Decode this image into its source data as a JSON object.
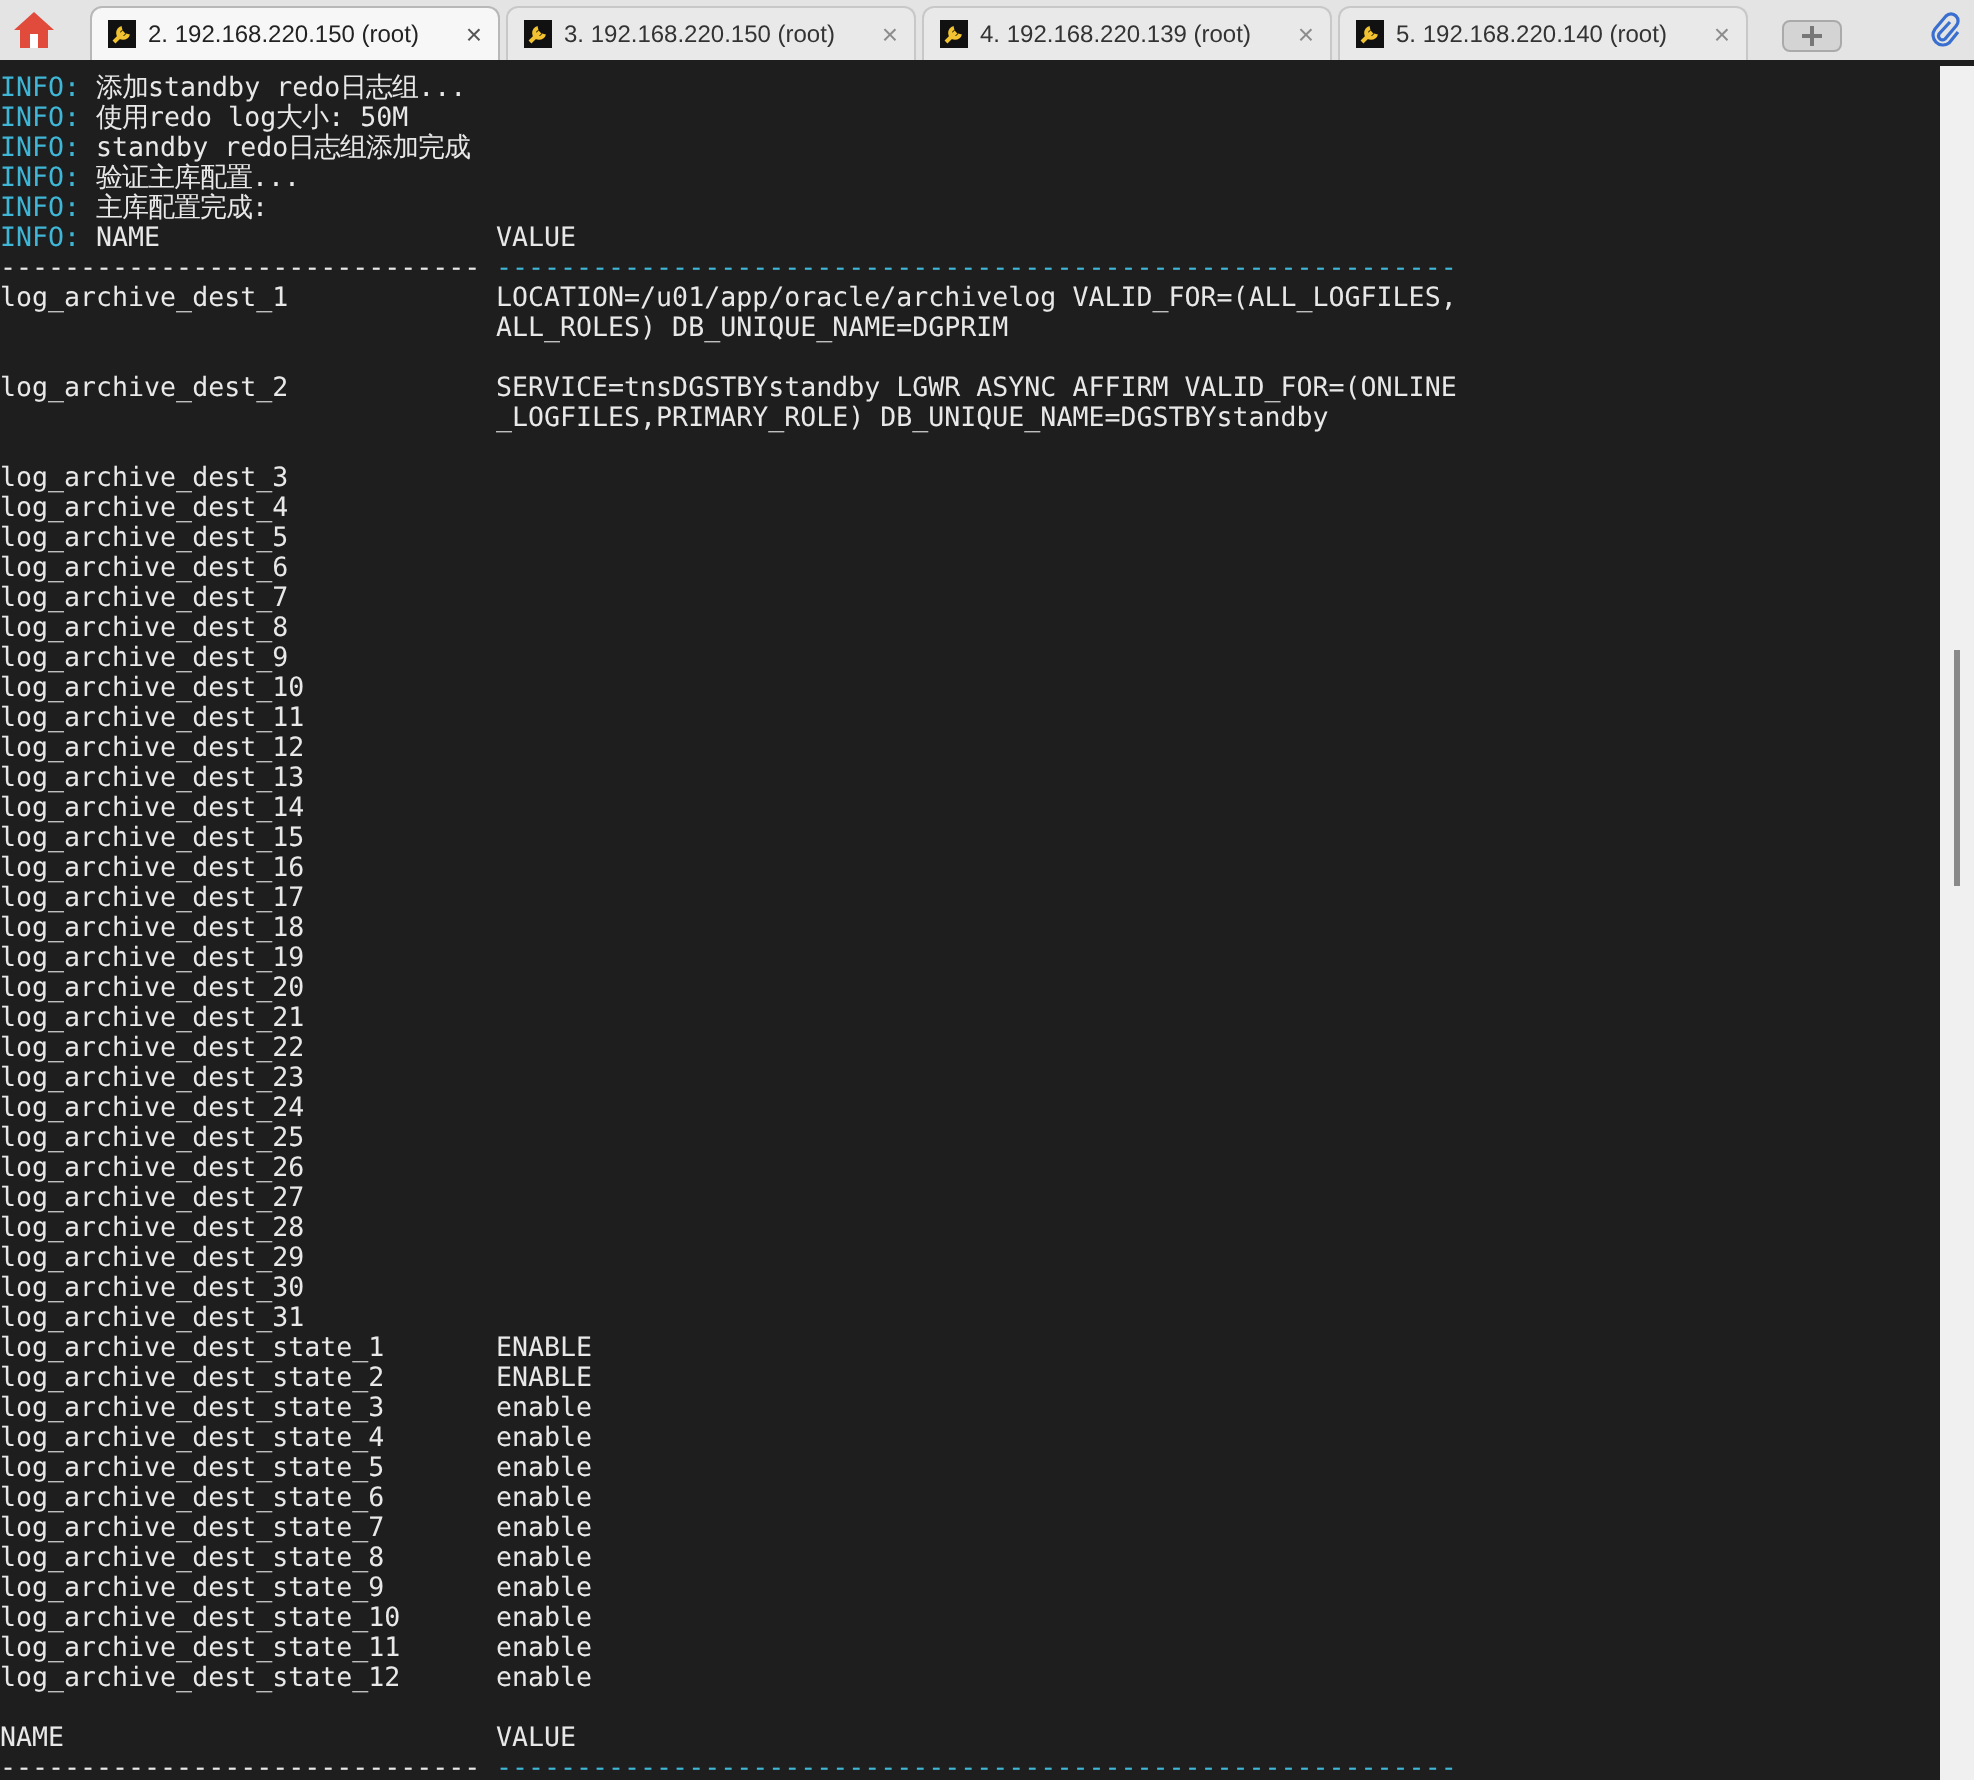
{
  "tabs": [
    {
      "label": "2. 192.168.220.150 (root)",
      "selected": true,
      "close": "×"
    },
    {
      "label": "3. 192.168.220.150 (root)",
      "selected": false,
      "close": "×"
    },
    {
      "label": "4. 192.168.220.139 (root)",
      "selected": false,
      "close": "×"
    },
    {
      "label": "5. 192.168.220.140 (root)",
      "selected": false,
      "close": "×"
    }
  ],
  "terminal": {
    "lines": [
      {
        "kind": "info",
        "prefix": "INFO:",
        "text": "添加standby redo日志组..."
      },
      {
        "kind": "info",
        "prefix": "INFO:",
        "text": "使用redo log大小: 50M"
      },
      {
        "kind": "info",
        "prefix": "INFO:",
        "text": "standby redo日志组添加完成"
      },
      {
        "kind": "info",
        "prefix": "INFO:",
        "text": "验证主库配置..."
      },
      {
        "kind": "info",
        "prefix": "INFO:",
        "text": "主库配置完成:"
      },
      {
        "kind": "header",
        "prefix": "INFO:",
        "name": "NAME",
        "value": "VALUE"
      },
      {
        "kind": "rule",
        "left": "------------------------------",
        "right": "------------------------------------------------------------"
      },
      {
        "kind": "row",
        "name": "log_archive_dest_1",
        "value": [
          "LOCATION=/u01/app/oracle/archivelog VALID_FOR=(ALL_LOGFILES,",
          "ALL_ROLES) DB_UNIQUE_NAME=DGPRIM"
        ]
      },
      {
        "kind": "blank"
      },
      {
        "kind": "row",
        "name": "log_archive_dest_2",
        "value": [
          "SERVICE=tnsDGSTBYstandby LGWR ASYNC AFFIRM VALID_FOR=(ONLINE",
          "_LOGFILES,PRIMARY_ROLE) DB_UNIQUE_NAME=DGSTBYstandby"
        ]
      },
      {
        "kind": "blank"
      },
      {
        "kind": "row",
        "name": "log_archive_dest_3"
      },
      {
        "kind": "row",
        "name": "log_archive_dest_4"
      },
      {
        "kind": "row",
        "name": "log_archive_dest_5"
      },
      {
        "kind": "row",
        "name": "log_archive_dest_6"
      },
      {
        "kind": "row",
        "name": "log_archive_dest_7"
      },
      {
        "kind": "row",
        "name": "log_archive_dest_8"
      },
      {
        "kind": "row",
        "name": "log_archive_dest_9"
      },
      {
        "kind": "row",
        "name": "log_archive_dest_10"
      },
      {
        "kind": "row",
        "name": "log_archive_dest_11"
      },
      {
        "kind": "row",
        "name": "log_archive_dest_12"
      },
      {
        "kind": "row",
        "name": "log_archive_dest_13"
      },
      {
        "kind": "row",
        "name": "log_archive_dest_14"
      },
      {
        "kind": "row",
        "name": "log_archive_dest_15"
      },
      {
        "kind": "row",
        "name": "log_archive_dest_16"
      },
      {
        "kind": "row",
        "name": "log_archive_dest_17"
      },
      {
        "kind": "row",
        "name": "log_archive_dest_18"
      },
      {
        "kind": "row",
        "name": "log_archive_dest_19"
      },
      {
        "kind": "row",
        "name": "log_archive_dest_20"
      },
      {
        "kind": "row",
        "name": "log_archive_dest_21"
      },
      {
        "kind": "row",
        "name": "log_archive_dest_22"
      },
      {
        "kind": "row",
        "name": "log_archive_dest_23"
      },
      {
        "kind": "row",
        "name": "log_archive_dest_24"
      },
      {
        "kind": "row",
        "name": "log_archive_dest_25"
      },
      {
        "kind": "row",
        "name": "log_archive_dest_26"
      },
      {
        "kind": "row",
        "name": "log_archive_dest_27"
      },
      {
        "kind": "row",
        "name": "log_archive_dest_28"
      },
      {
        "kind": "row",
        "name": "log_archive_dest_29"
      },
      {
        "kind": "row",
        "name": "log_archive_dest_30"
      },
      {
        "kind": "row",
        "name": "log_archive_dest_31"
      },
      {
        "kind": "row",
        "name": "log_archive_dest_state_1",
        "value": [
          "ENABLE"
        ]
      },
      {
        "kind": "row",
        "name": "log_archive_dest_state_2",
        "value": [
          "ENABLE"
        ]
      },
      {
        "kind": "row",
        "name": "log_archive_dest_state_3",
        "value": [
          "enable"
        ]
      },
      {
        "kind": "row",
        "name": "log_archive_dest_state_4",
        "value": [
          "enable"
        ]
      },
      {
        "kind": "row",
        "name": "log_archive_dest_state_5",
        "value": [
          "enable"
        ]
      },
      {
        "kind": "row",
        "name": "log_archive_dest_state_6",
        "value": [
          "enable"
        ]
      },
      {
        "kind": "row",
        "name": "log_archive_dest_state_7",
        "value": [
          "enable"
        ]
      },
      {
        "kind": "row",
        "name": "log_archive_dest_state_8",
        "value": [
          "enable"
        ]
      },
      {
        "kind": "row",
        "name": "log_archive_dest_state_9",
        "value": [
          "enable"
        ]
      },
      {
        "kind": "row",
        "name": "log_archive_dest_state_10",
        "value": [
          "enable"
        ]
      },
      {
        "kind": "row",
        "name": "log_archive_dest_state_11",
        "value": [
          "enable"
        ]
      },
      {
        "kind": "row",
        "name": "log_archive_dest_state_12",
        "value": [
          "enable"
        ]
      },
      {
        "kind": "blank"
      },
      {
        "kind": "header",
        "name": "NAME",
        "value": "VALUE"
      },
      {
        "kind": "rule",
        "left": "------------------------------",
        "right": "------------------------------------------------------------"
      }
    ]
  }
}
